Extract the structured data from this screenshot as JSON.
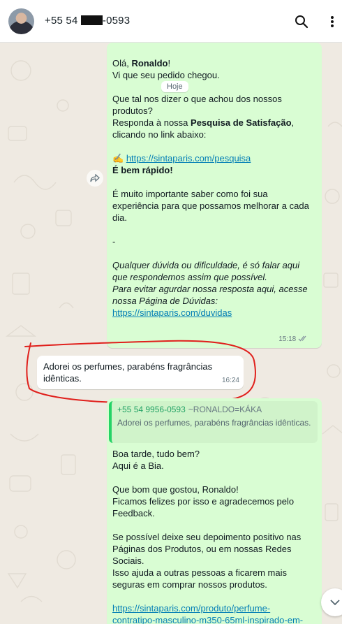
{
  "header": {
    "contact_prefix": "+55 54 ",
    "contact_suffix": "-0593"
  },
  "date_label": "Hoje",
  "message1": {
    "greeting": "Olá, ",
    "name": "Ronaldo",
    "greeting_end": "!",
    "line2": "Vi que seu pedido chegou.",
    "line3": "Que tal nos dizer o que achou dos nossos produtos?",
    "line4_a": "Responda à nossa ",
    "line4_b": "Pesquisa de Satisfação",
    "line4_c": ", clicando no link abaixo:",
    "link1_emoji": "✍",
    "link1": "https://sintaparis.com/pesquisa",
    "fast": "É bem rápido!",
    "important": "É muito importante saber como foi sua experiência para que possamos melhorar a cada dia.",
    "dash": "-",
    "italic1": "Qualquer dúvida ou dificuldade, é só falar aqui que respondemos assim que possível.",
    "italic2": "Para evitar agurdar nossa resposta aqui, acesse nossa Página de Dúvidas:",
    "link2": "https://sintaparis.com/duvidas",
    "time": "15:18"
  },
  "message2": {
    "text": "Adorei os perfumes, parabéns fragrâncias idênticas.",
    "time": "16:24"
  },
  "message3": {
    "quote_number": "+55 54 9956-0593",
    "quote_name": "~RONALDO=KÁKA",
    "quote_text": "Adorei os perfumes, parabéns fragrâncias idênticas.",
    "l1": "Boa tarde, tudo bem?",
    "l2": "Aqui é a Bia.",
    "l3": "Que bom que gostou, Ronaldo!",
    "l4": "Ficamos felizes por isso e agradecemos pelo Feedback.",
    "l5": "Se possível deixe seu depoimento positivo nas Páginas dos Produtos, ou em nossas Redes Sociais.",
    "l6": "Isso ajuda a outras pessoas a ficarem mais seguras em comprar nossos produtos.",
    "link3_a": "https://sintaparis.com/produto/perfume-",
    "link3_b": "contratipo-masculino-m350-65ml-inspirado-em-"
  },
  "icons": {
    "search": "search-icon",
    "menu": "more-vertical-icon",
    "forward": "forward-icon",
    "scroll": "chevron-down-icon",
    "read": "double-check-icon"
  },
  "colors": {
    "outgoing_bubble": "#d9fdd3",
    "incoming_bubble": "#ffffff",
    "link": "#027eb5",
    "annotation_circle": "#e0201c"
  }
}
